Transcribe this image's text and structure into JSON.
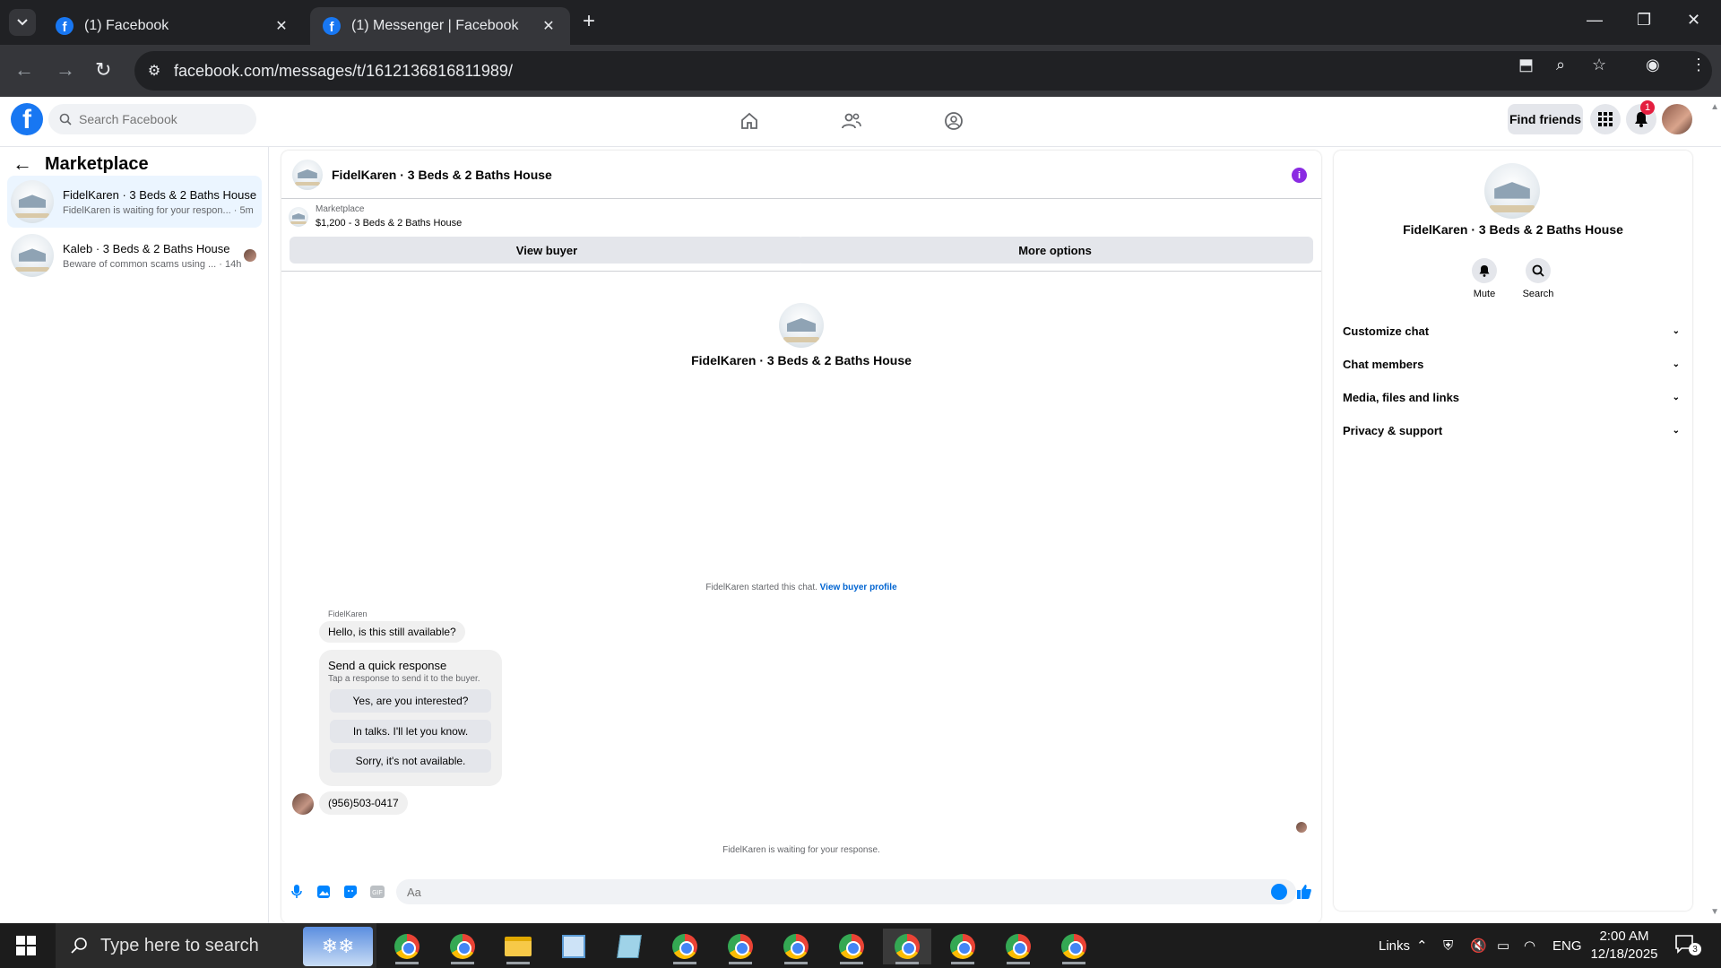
{
  "browser": {
    "tabs": [
      {
        "title": "(1) Facebook",
        "active": false
      },
      {
        "title": "(1) Messenger | Facebook",
        "active": true
      }
    ],
    "url": "facebook.com/messages/t/1612136816811989/"
  },
  "fb_header": {
    "search_placeholder": "Search Facebook",
    "find_friends": "Find friends",
    "notification_count": "1"
  },
  "sidebar": {
    "title": "Marketplace",
    "conversations": [
      {
        "name": "FidelKaren · 3 Beds & 2 Baths House",
        "preview": "FidelKaren is waiting for your respon... · 5m",
        "selected": true
      },
      {
        "name": "Kaleb · 3 Beds & 2 Baths House",
        "preview": "Beware of common scams using ... · 14h",
        "selected": false
      }
    ]
  },
  "chat": {
    "title": "FidelKaren · 3 Beds & 2 Baths House",
    "listing_category": "Marketplace",
    "listing_price_title": "$1,200 - 3 Beds & 2 Baths House",
    "view_buyer": "View buyer",
    "more_options": "More options",
    "center_name": "FidelKaren · 3 Beds & 2 Baths House",
    "started_text": "FidelKaren started this chat.",
    "view_buyer_profile": "View buyer profile",
    "sender_name": "FidelKaren",
    "first_message": "Hello, is this still available?",
    "quick_response_title": "Send a quick response",
    "quick_response_sub": "Tap a response to send it to the buyer.",
    "quick_responses": [
      "Yes, are you interested?",
      "In talks. I'll let you know.",
      "Sorry, it's not available."
    ],
    "second_message": "(956)503-0417",
    "waiting_text": "FidelKaren is waiting for your response.",
    "composer_placeholder": "Aa"
  },
  "info_panel": {
    "name": "FidelKaren · 3 Beds & 2 Baths House",
    "actions": [
      {
        "label": "Mute",
        "icon": "bell-icon"
      },
      {
        "label": "Search",
        "icon": "search-icon"
      }
    ],
    "sections": [
      "Customize chat",
      "Chat members",
      "Media, files and links",
      "Privacy & support"
    ]
  },
  "taskbar": {
    "search_placeholder": "Type here to search",
    "links_label": "Links",
    "language": "ENG",
    "time": "2:00 AM",
    "date": "12/18/2025",
    "notification_count": "3"
  },
  "colors": {
    "facebook_blue": "#1877f2",
    "messenger_blue": "#0084ff",
    "selected_conversation": "#ebf5ff",
    "info_accent": "#8a2be2"
  }
}
